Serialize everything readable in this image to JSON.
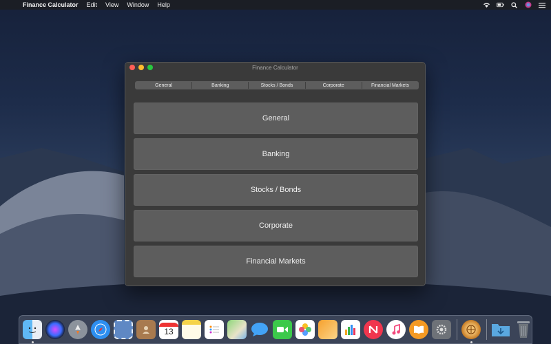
{
  "menubar": {
    "app_name": "Finance Calculator",
    "items": [
      "Edit",
      "View",
      "Window",
      "Help"
    ]
  },
  "window": {
    "title": "Finance Calculator",
    "tabs": [
      "General",
      "Banking",
      "Stocks / Bonds",
      "Corporate",
      "Financial Markets"
    ],
    "buttons": [
      "General",
      "Banking",
      "Stocks / Bonds",
      "Corporate",
      "Financial Markets"
    ]
  },
  "dock": {
    "calendar_day": "13",
    "items": [
      "finder-icon",
      "siri-icon",
      "launchpad-icon",
      "safari-icon",
      "mail-stamp-icon",
      "contacts-icon",
      "calendar-icon",
      "notes-icon",
      "reminders-icon",
      "maps-icon",
      "messages-icon",
      "facetime-icon",
      "photos-icon",
      "pages-icon",
      "numbers-icon",
      "news-icon",
      "music-icon",
      "books-icon",
      "system-preferences-icon",
      "finance-calculator-icon",
      "downloads-folder-icon",
      "trash-icon"
    ]
  },
  "colors": {
    "window_bg": "#3a3a3a",
    "button_bg": "#5d5d5d",
    "close": "#fe5f57",
    "minimize": "#febc2e",
    "zoom": "#28c840"
  }
}
